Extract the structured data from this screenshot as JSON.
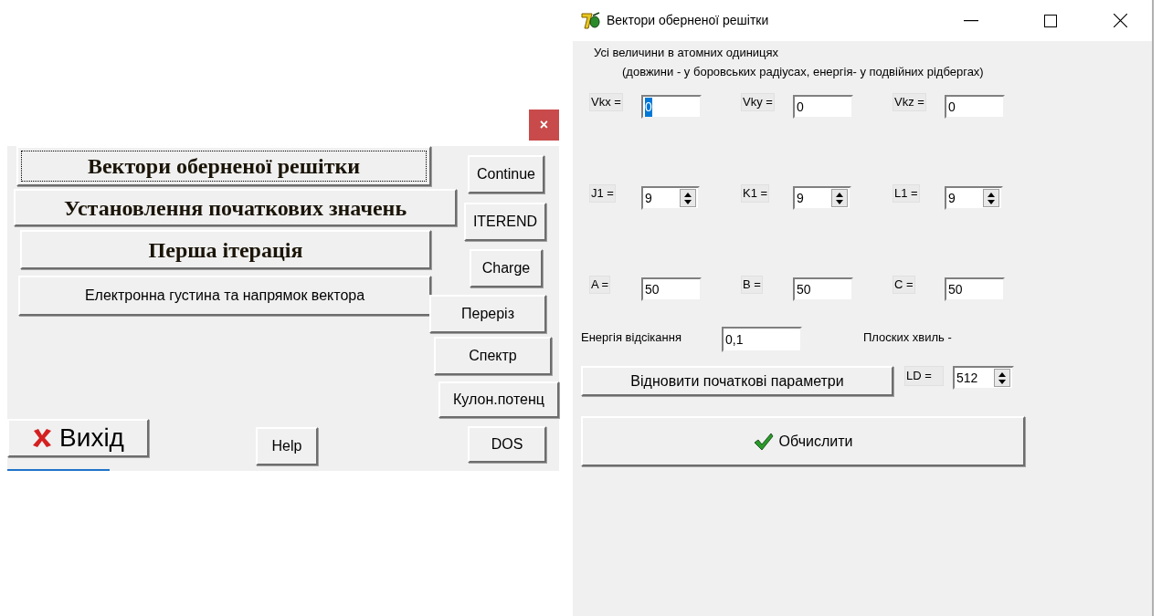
{
  "main_window": {
    "close_button": "×",
    "large_buttons": [
      {
        "label": "Вектори оберненої решітки",
        "kind": "heading",
        "focused": true
      },
      {
        "label": "Установлення початкових значень",
        "kind": "heading",
        "focused": false
      },
      {
        "label": "Перша ітерація",
        "kind": "heading",
        "focused": false
      },
      {
        "label": "Електронна густина та напрямок вектора",
        "kind": "plain",
        "focused": false
      }
    ],
    "side_buttons": [
      "Continue",
      "ITEREND",
      "Charge",
      "Переріз",
      "Спектр",
      "Кулон.потенц",
      "DOS"
    ],
    "exit_button": "Вихід",
    "help_button": "Help"
  },
  "dialog": {
    "title": "Вектори оберненої решітки",
    "note": [
      "Усі величини в атомних одиницях",
      "(довжини - у боровських радіусах, енергія- у  подвійних рідбергах)"
    ],
    "field_rows": [
      [
        {
          "label": "Vkx =",
          "value": "0",
          "kind": "text",
          "selected": true
        },
        {
          "label": "Vky =",
          "value": "0",
          "kind": "text",
          "selected": false
        },
        {
          "label": "Vkz =",
          "value": "0",
          "kind": "text",
          "selected": false
        }
      ],
      [
        {
          "label": "J1 =",
          "value": "9",
          "kind": "spin",
          "selected": false
        },
        {
          "label": "K1 =",
          "value": "9",
          "kind": "spin",
          "selected": false
        },
        {
          "label": "L1 =",
          "value": "9",
          "kind": "spin",
          "selected": false
        }
      ],
      [
        {
          "label": "A =",
          "value": "50",
          "kind": "text",
          "selected": false
        },
        {
          "label": "B =",
          "value": "50",
          "kind": "text",
          "selected": false
        },
        {
          "label": "C =",
          "value": "50",
          "kind": "text",
          "selected": false
        }
      ]
    ],
    "cutoff_label": "Енергія відсікання",
    "cutoff_value": "0,1",
    "plane_waves_label": "Плоских хвиль -",
    "restore_button": "Відновити початкові параметри",
    "ld_label": "LD =",
    "ld_value": "512",
    "compute_button": "Обчислити"
  }
}
